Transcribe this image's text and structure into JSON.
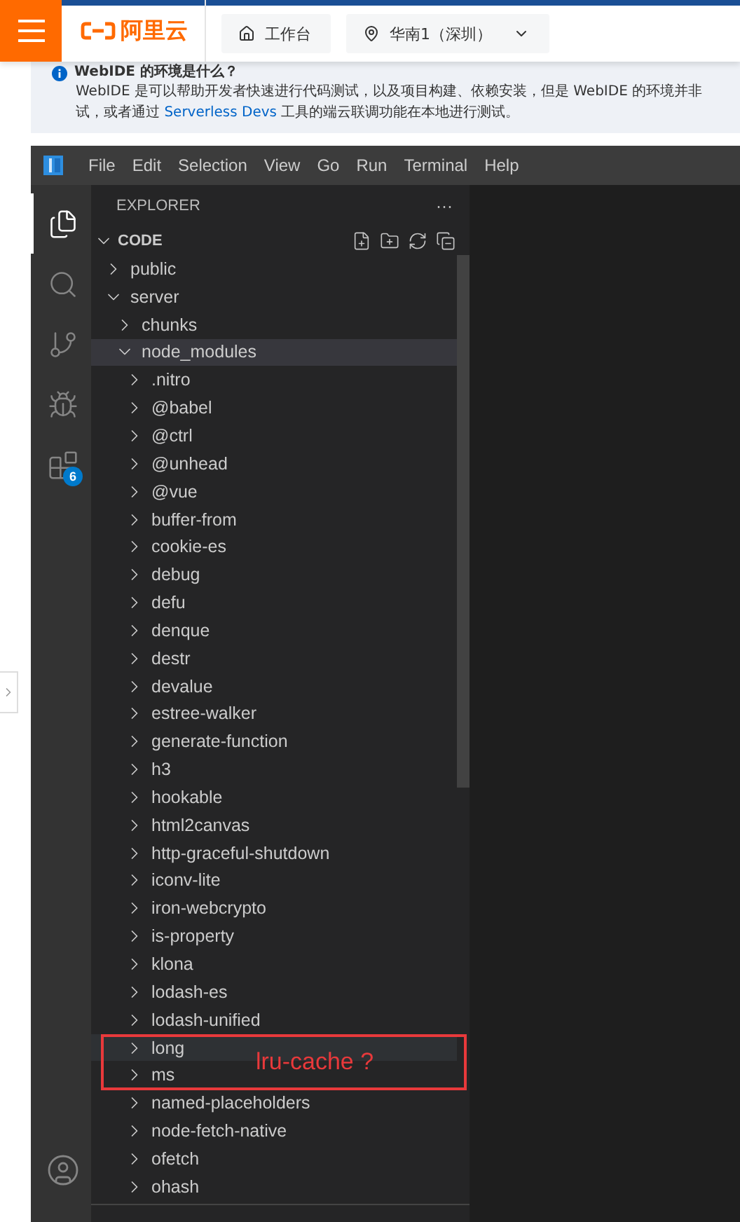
{
  "header": {
    "logo": "阿里云",
    "workbench": "工作台",
    "region": "华南1（深圳）"
  },
  "notice": {
    "title": "WebIDE 的环境是什么？",
    "line_1": "WebIDE 是可以帮助开发者快速进行代码测试，以及项目构建、依赖安装，但是 WebIDE 的环境并非",
    "line_2_before": "试，或者通过",
    "line_2_link": "Serverless Devs",
    "line_2_after": "工具的端云联调功能在本地进行测试。"
  },
  "menu": [
    "File",
    "Edit",
    "Selection",
    "View",
    "Go",
    "Run",
    "Terminal",
    "Help"
  ],
  "activity": [
    {
      "kind": "files",
      "selected": true
    },
    {
      "kind": "search",
      "selected": false
    },
    {
      "kind": "scm",
      "selected": false
    },
    {
      "kind": "debug",
      "selected": false
    },
    {
      "kind": "extensions",
      "selected": false,
      "badge": "6"
    }
  ],
  "explorer": {
    "title": "EXPLORER",
    "more": "···",
    "root": "CODE",
    "tree": [
      {
        "label": "public",
        "expanded": false,
        "selected": false,
        "hovered": false
      },
      {
        "label": "server",
        "expanded": true,
        "selected": false,
        "hovered": false,
        "children": [
          {
            "label": "chunks",
            "expanded": false,
            "selected": false,
            "hovered": false
          },
          {
            "label": "node_modules",
            "expanded": true,
            "selected": true,
            "hovered": false,
            "children": [
              {
                "label": ".nitro",
                "expanded": false,
                "selected": false,
                "hovered": false
              },
              {
                "label": "@babel",
                "expanded": false,
                "selected": false,
                "hovered": false
              },
              {
                "label": "@ctrl",
                "expanded": false,
                "selected": false,
                "hovered": false
              },
              {
                "label": "@unhead",
                "expanded": false,
                "selected": false,
                "hovered": false
              },
              {
                "label": "@vue",
                "expanded": false,
                "selected": false,
                "hovered": false
              },
              {
                "label": "buffer-from",
                "expanded": false,
                "selected": false,
                "hovered": false
              },
              {
                "label": "cookie-es",
                "expanded": false,
                "selected": false,
                "hovered": false
              },
              {
                "label": "debug",
                "expanded": false,
                "selected": false,
                "hovered": false
              },
              {
                "label": "defu",
                "expanded": false,
                "selected": false,
                "hovered": false
              },
              {
                "label": "denque",
                "expanded": false,
                "selected": false,
                "hovered": false
              },
              {
                "label": "destr",
                "expanded": false,
                "selected": false,
                "hovered": false
              },
              {
                "label": "devalue",
                "expanded": false,
                "selected": false,
                "hovered": false
              },
              {
                "label": "estree-walker",
                "expanded": false,
                "selected": false,
                "hovered": false
              },
              {
                "label": "generate-function",
                "expanded": false,
                "selected": false,
                "hovered": false
              },
              {
                "label": "h3",
                "expanded": false,
                "selected": false,
                "hovered": false
              },
              {
                "label": "hookable",
                "expanded": false,
                "selected": false,
                "hovered": false
              },
              {
                "label": "html2canvas",
                "expanded": false,
                "selected": false,
                "hovered": false
              },
              {
                "label": "http-graceful-shutdown",
                "expanded": false,
                "selected": false,
                "hovered": false
              },
              {
                "label": "iconv-lite",
                "expanded": false,
                "selected": false,
                "hovered": false
              },
              {
                "label": "iron-webcrypto",
                "expanded": false,
                "selected": false,
                "hovered": false
              },
              {
                "label": "is-property",
                "expanded": false,
                "selected": false,
                "hovered": false
              },
              {
                "label": "klona",
                "expanded": false,
                "selected": false,
                "hovered": false
              },
              {
                "label": "lodash-es",
                "expanded": false,
                "selected": false,
                "hovered": false
              },
              {
                "label": "lodash-unified",
                "expanded": false,
                "selected": false,
                "hovered": false
              },
              {
                "label": "long",
                "expanded": false,
                "selected": false,
                "hovered": true
              },
              {
                "label": "ms",
                "expanded": false,
                "selected": false,
                "hovered": false
              },
              {
                "label": "named-placeholders",
                "expanded": false,
                "selected": false,
                "hovered": false
              },
              {
                "label": "node-fetch-native",
                "expanded": false,
                "selected": false,
                "hovered": false
              },
              {
                "label": "ofetch",
                "expanded": false,
                "selected": false,
                "hovered": false
              },
              {
                "label": "ohash",
                "expanded": false,
                "selected": false,
                "hovered": false
              }
            ]
          }
        ]
      }
    ]
  },
  "annotation": {
    "text": "lru-cache ?"
  }
}
